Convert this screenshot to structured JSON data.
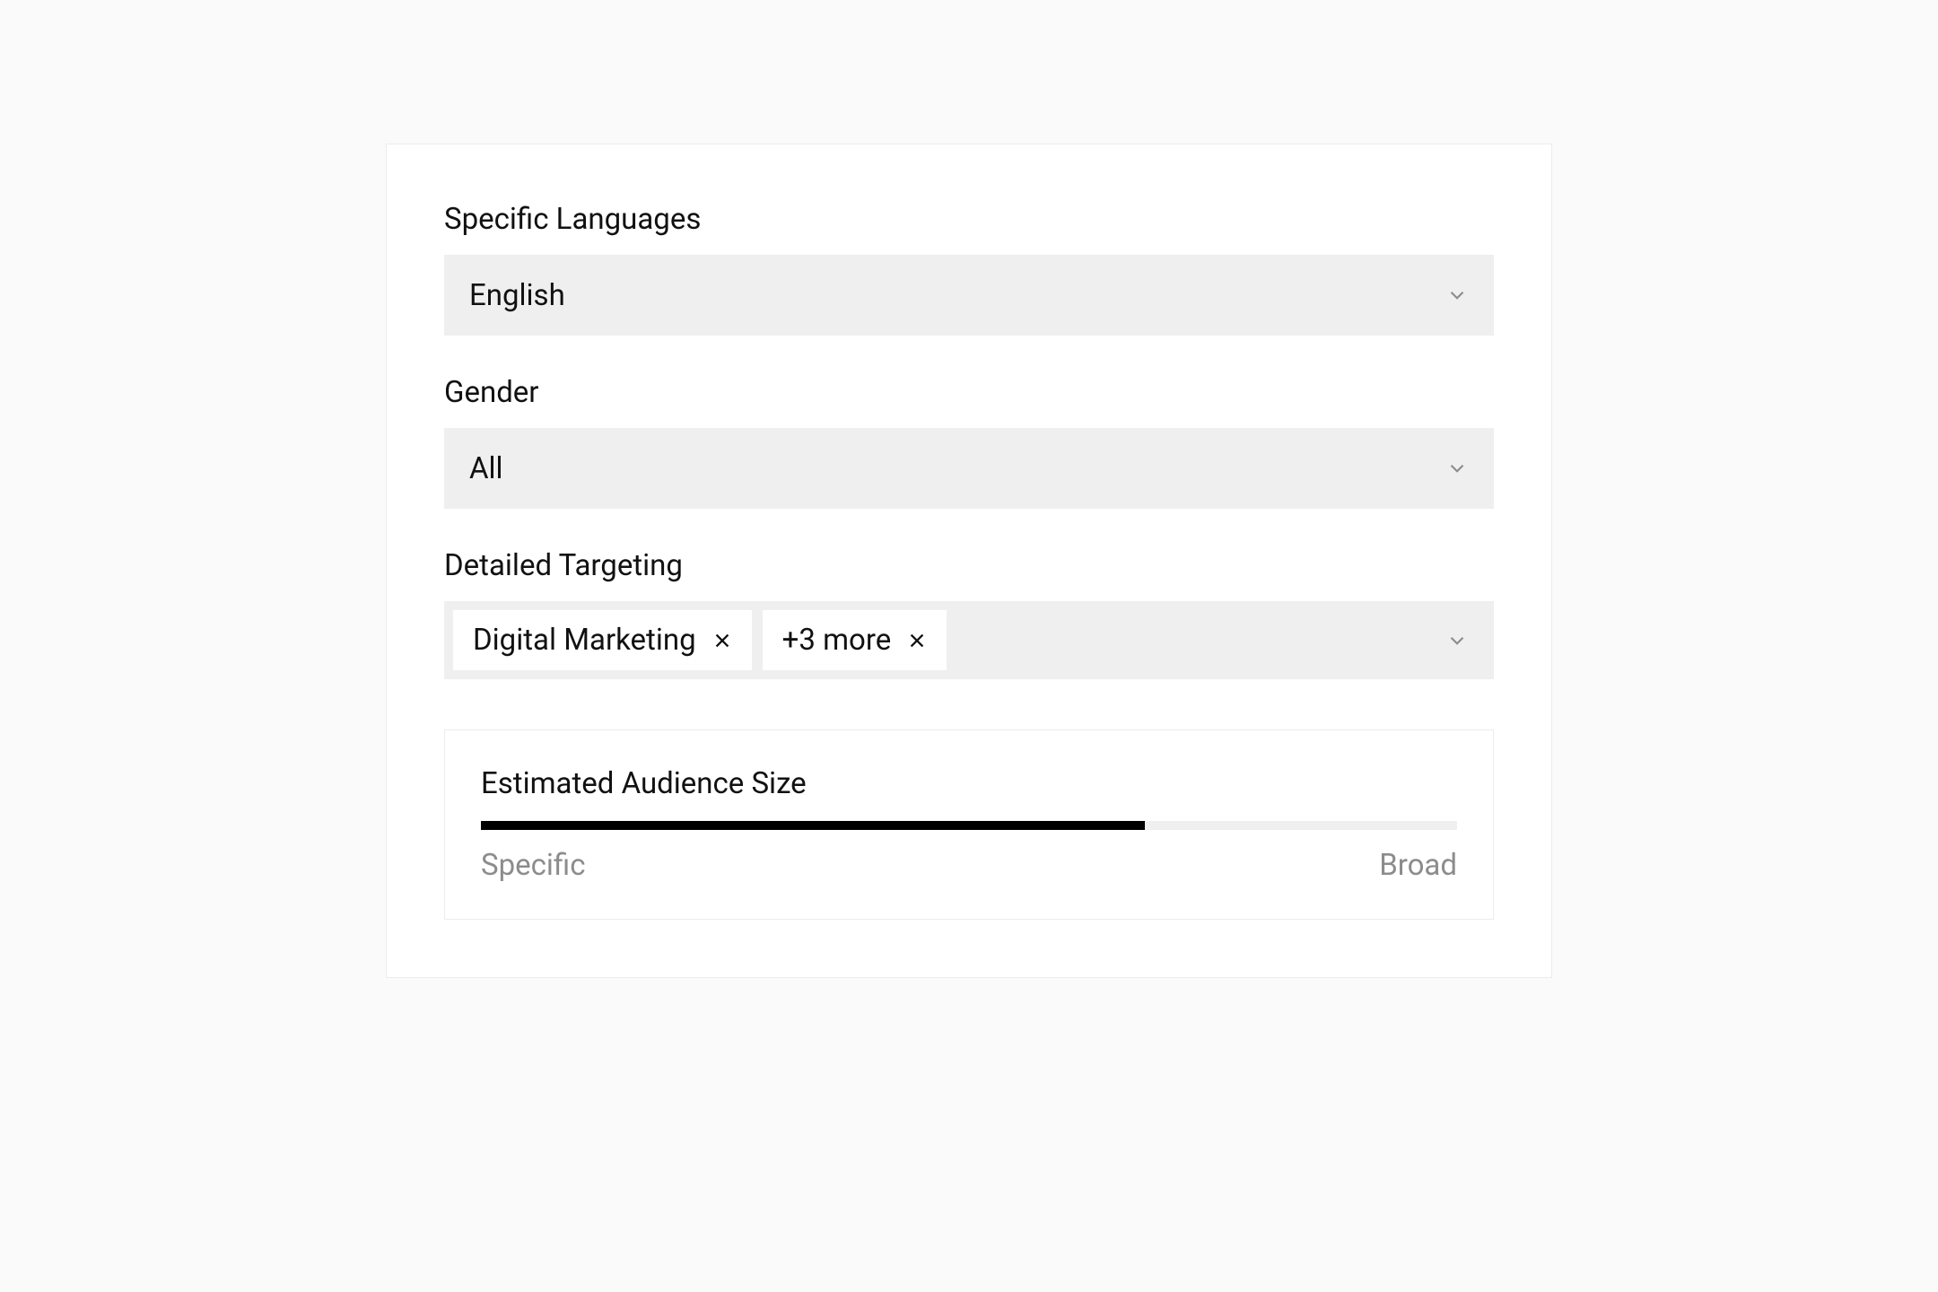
{
  "fields": {
    "languages": {
      "label": "Specific Languages",
      "value": "English"
    },
    "gender": {
      "label": "Gender",
      "value": "All"
    },
    "targeting": {
      "label": "Detailed Targeting",
      "tags": [
        {
          "label": "Digital Marketing"
        },
        {
          "label": "+3 more"
        }
      ]
    }
  },
  "audience": {
    "title": "Estimated Audience Size",
    "fill_percent": 68,
    "left_label": "Specific",
    "right_label": "Broad"
  }
}
